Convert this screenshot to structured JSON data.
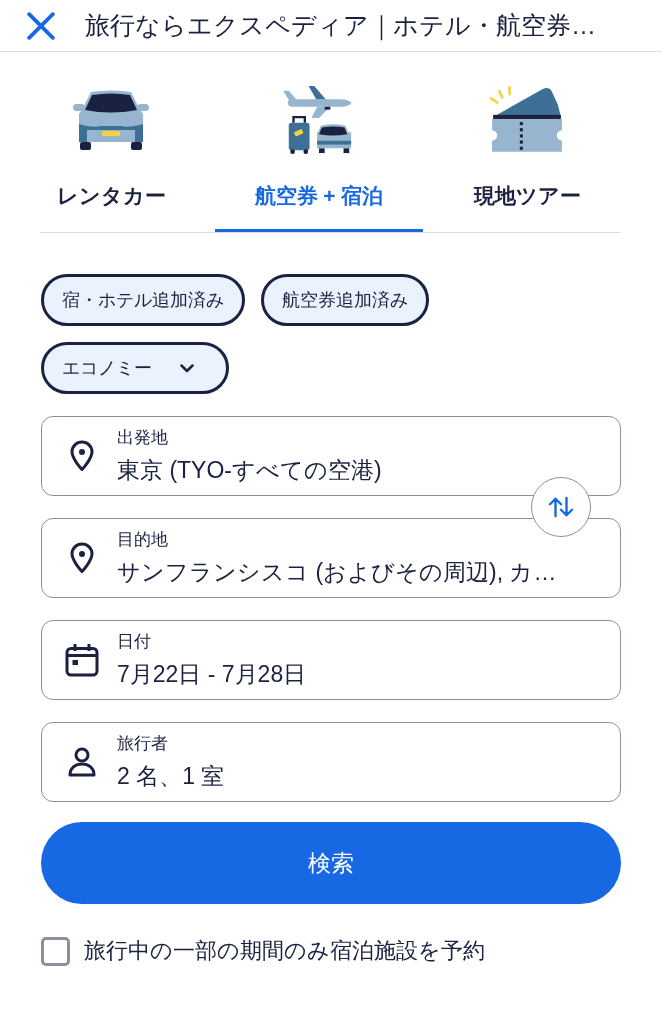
{
  "header": {
    "title": "旅行ならエクスペディア｜ホテル・航空券…"
  },
  "tabs": [
    {
      "kind": "car",
      "label": "レンタカー",
      "selected": false
    },
    {
      "kind": "package",
      "label": "航空券 + 宿泊",
      "selected": true
    },
    {
      "kind": "ticket",
      "label": "現地ツアー",
      "selected": false
    }
  ],
  "chips": [
    {
      "label": "宿・ホテル追加済み",
      "selected": true
    },
    {
      "label": "航空券追加済み",
      "selected": true
    }
  ],
  "cabin_class": {
    "value": "エコノミー"
  },
  "fields": [
    {
      "kind": "location",
      "label": "出発地",
      "value": "東京 (TYO-すべての空港)"
    },
    {
      "kind": "location",
      "label": "目的地",
      "value": "サンフランシスコ (およびその周辺), カ…"
    },
    {
      "kind": "date",
      "label": "日付",
      "value": "7月22日 - 7月28日"
    },
    {
      "kind": "travelers",
      "label": "旅行者",
      "value": "2 名、1 室"
    }
  ],
  "search_button": {
    "label": "検索"
  },
  "checkbox": {
    "label": "旅行中の一部の期間のみ宿泊施設を予約",
    "checked": false
  }
}
